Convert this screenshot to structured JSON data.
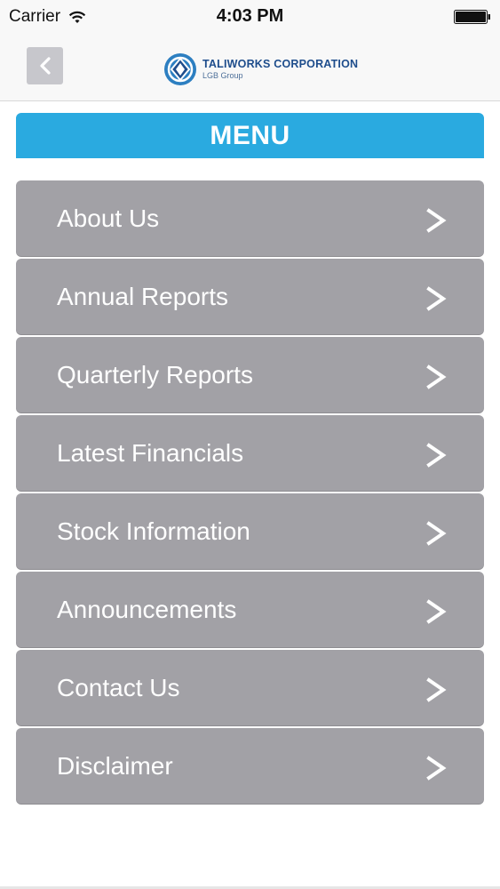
{
  "status_bar": {
    "carrier": "Carrier",
    "time": "4:03 PM"
  },
  "nav": {
    "back_label": "<",
    "logo_title": "TALIWORKS CORPORATION",
    "logo_subtitle": "LGB Group"
  },
  "menu": {
    "title": "MENU",
    "items": [
      {
        "label": "About Us",
        "chevron": ">"
      },
      {
        "label": "Annual Reports",
        "chevron": ">"
      },
      {
        "label": "Quarterly Reports",
        "chevron": ">"
      },
      {
        "label": "Latest Financials",
        "chevron": ">"
      },
      {
        "label": "Stock Information",
        "chevron": ">"
      },
      {
        "label": "Announcements",
        "chevron": ">"
      },
      {
        "label": "Contact Us",
        "chevron": ">"
      },
      {
        "label": "Disclaimer",
        "chevron": ">"
      }
    ]
  },
  "colors": {
    "header": "#2aaae0",
    "item_bg": "#a2a1a6",
    "logo": "#1e4d8c"
  }
}
